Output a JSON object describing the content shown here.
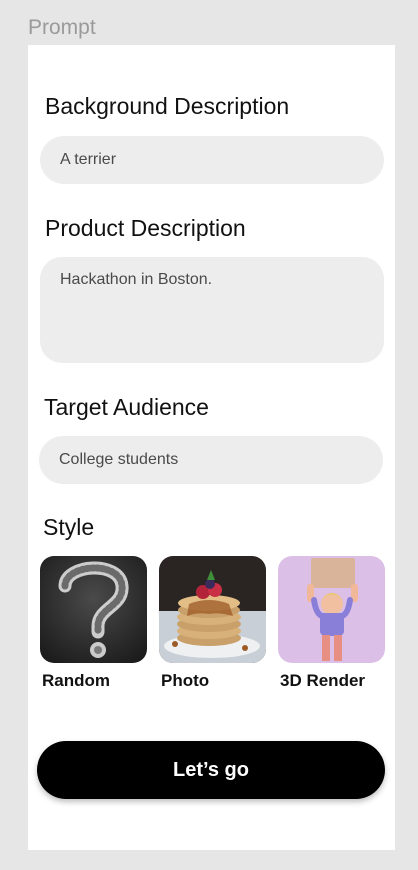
{
  "frame": {
    "label": "Prompt"
  },
  "background": {
    "label": "Background Description",
    "value": "A terrier"
  },
  "product": {
    "label": "Product Description",
    "value": "Hackathon in Boston."
  },
  "audience": {
    "label": "Target Audience",
    "value": "College students"
  },
  "style": {
    "label": "Style",
    "options": [
      {
        "label": "Random",
        "icon": "question-mark-chalk-image"
      },
      {
        "label": "Photo",
        "icon": "pancakes-photo-image"
      },
      {
        "label": "3D Render",
        "icon": "3d-character-render-image"
      }
    ]
  },
  "actions": {
    "submit_label": "Let’s go"
  },
  "colors": {
    "page_bg": "#e6e6e6",
    "card_bg": "#ffffff",
    "field_bg": "#ededed",
    "button_bg": "#000000",
    "button_text": "#ffffff"
  }
}
